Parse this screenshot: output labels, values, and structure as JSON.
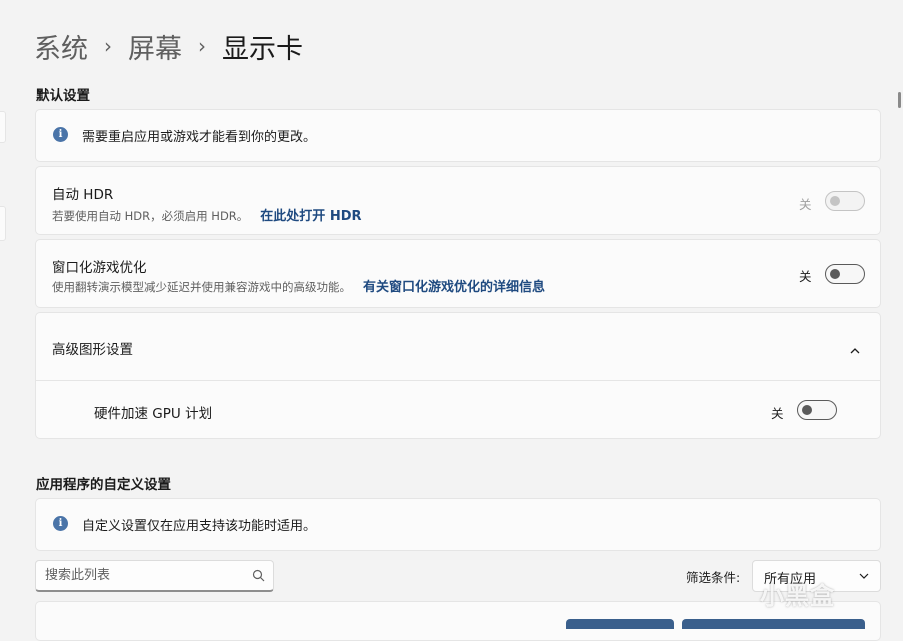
{
  "breadcrumb": {
    "items": [
      "系统",
      "屏幕"
    ],
    "separator": "›",
    "current": "显示卡"
  },
  "default_settings": {
    "title": "默认设置",
    "info": "需要重启应用或游戏才能看到你的更改。",
    "auto_hdr": {
      "title": "自动 HDR",
      "description": "若要使用自动 HDR，必须启用 HDR。",
      "link": "在此处打开 HDR",
      "toggle_label": "关",
      "enabled": false,
      "disabled": true
    },
    "windowed_game_opt": {
      "title": "窗口化游戏优化",
      "description": "使用翻转演示模型减少延迟并使用兼容游戏中的高级功能。",
      "link": "有关窗口化游戏优化的详细信息",
      "toggle_label": "关",
      "enabled": false
    },
    "advanced_graphics": {
      "title": "高级图形设置",
      "expanded": true,
      "hw_gpu_scheduling": {
        "title": "硬件加速 GPU 计划",
        "toggle_label": "关",
        "enabled": false
      }
    }
  },
  "custom_settings": {
    "title": "应用程序的自定义设置",
    "info": "自定义设置仅在应用支持该功能时适用。",
    "search": {
      "placeholder": "搜索此列表"
    },
    "filter": {
      "label": "筛选条件:",
      "value": "所有应用"
    }
  },
  "watermark": "小黑盒",
  "icons": {
    "info": "info-icon",
    "chevron": "chevron-up-icon",
    "search": "search-icon",
    "dropdown": "chevron-down-icon"
  },
  "colors": {
    "accent_link": "#1f4a80",
    "info_icon": "#4a74a8",
    "background": "#f3f3f3",
    "card": "#fbfbfb"
  }
}
